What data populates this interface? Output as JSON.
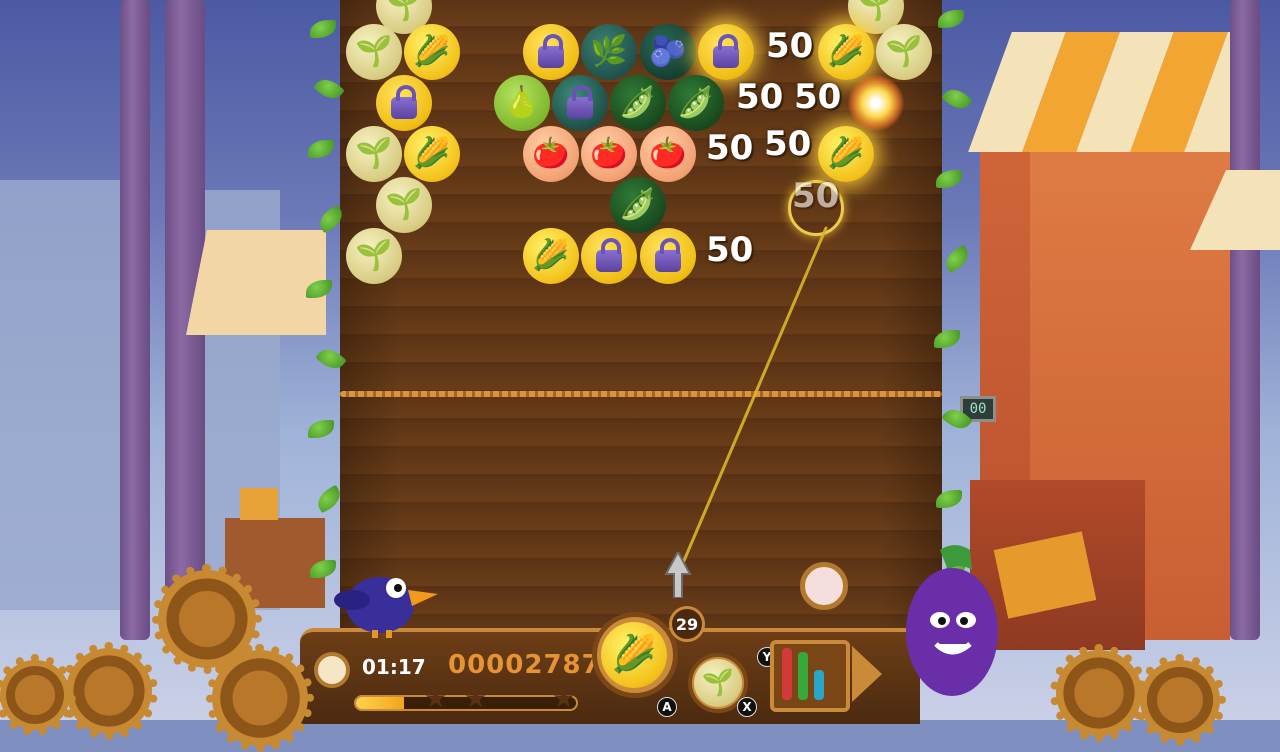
{
  "floating_scores": [
    {
      "label": "50"
    },
    {
      "label": "50"
    },
    {
      "label": "50"
    },
    {
      "label": "50"
    },
    {
      "label": "50"
    },
    {
      "label": "50"
    },
    {
      "label": "50"
    }
  ],
  "bubbles": {
    "left_column": [
      "radish",
      "radish",
      "corn",
      "grape-lock",
      "radish",
      "corn",
      "radish",
      "radish"
    ],
    "cluster": [
      "grape-lock",
      "basil",
      "berry-monster",
      "grape-lock",
      "pear",
      "grape-lock",
      "pea",
      "pea",
      "tomato",
      "tomato",
      "tomato",
      "pea",
      "corn",
      "grape-lock",
      "grape-lock"
    ],
    "right_column": [
      "radish",
      "corn",
      "radish",
      "corn",
      "corn"
    ]
  },
  "hud": {
    "timer": "01:17",
    "score": "00002787",
    "shots_left": "29",
    "progress": 0.22,
    "stars_earned": 0,
    "stars_total": 3,
    "current_bubble": "corn",
    "next_bubble": "radish",
    "button_a": "A",
    "button_x": "X",
    "button_y": "Y"
  },
  "scale_display": "00",
  "colors": {
    "accent": "#c98a3a",
    "score_text": "#e59334",
    "board": "#5b3415"
  }
}
